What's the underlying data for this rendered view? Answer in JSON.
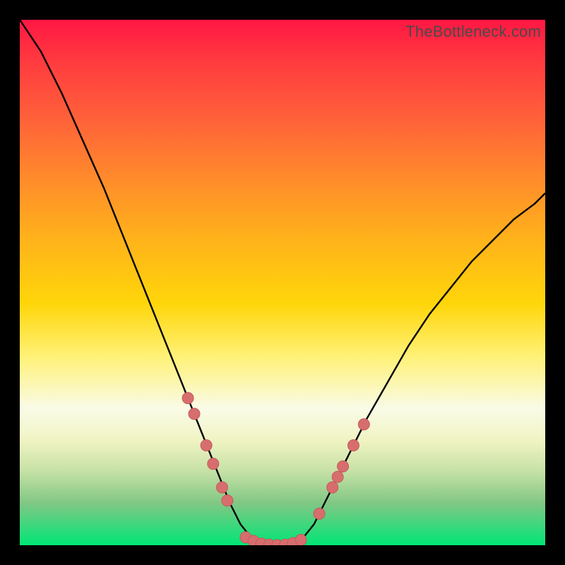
{
  "watermark": {
    "text": "TheBottleneck.com"
  },
  "colors": {
    "curve_stroke": "#000000",
    "marker_fill": "#d76e6e",
    "marker_stroke": "#c65a5a",
    "frame_bg": "#000000"
  },
  "chart_data": {
    "type": "line",
    "title": "",
    "xlabel": "",
    "ylabel": "",
    "xlim": [
      0,
      100
    ],
    "ylim": [
      0,
      100
    ],
    "grid": false,
    "legend": false,
    "series": [
      {
        "name": "bottleneck-curve",
        "x": [
          0,
          4,
          8,
          12,
          16,
          20,
          24,
          28,
          32,
          34,
          36,
          38,
          40,
          42,
          44,
          46,
          48,
          50,
          52,
          54,
          56,
          58,
          62,
          66,
          70,
          74,
          78,
          82,
          86,
          90,
          94,
          98,
          100
        ],
        "y": [
          100,
          94,
          86,
          77,
          68,
          58,
          48,
          38,
          28,
          23,
          18,
          13,
          8,
          4,
          1.5,
          0.5,
          0,
          0,
          0.5,
          1.5,
          4,
          8,
          16,
          24,
          31,
          38,
          44,
          49,
          54,
          58,
          62,
          65,
          67
        ]
      }
    ],
    "markers": [
      {
        "x": 32.0,
        "y": 28.0
      },
      {
        "x": 33.2,
        "y": 25.0
      },
      {
        "x": 35.5,
        "y": 19.0
      },
      {
        "x": 36.8,
        "y": 15.5
      },
      {
        "x": 38.5,
        "y": 11.0
      },
      {
        "x": 39.5,
        "y": 8.5
      },
      {
        "x": 43.0,
        "y": 1.5
      },
      {
        "x": 44.5,
        "y": 0.8
      },
      {
        "x": 46.0,
        "y": 0.3
      },
      {
        "x": 47.5,
        "y": 0.1
      },
      {
        "x": 49.0,
        "y": 0.0
      },
      {
        "x": 50.5,
        "y": 0.1
      },
      {
        "x": 52.0,
        "y": 0.4
      },
      {
        "x": 53.5,
        "y": 1.0
      },
      {
        "x": 57.0,
        "y": 6.0
      },
      {
        "x": 59.5,
        "y": 11.0
      },
      {
        "x": 60.5,
        "y": 13.0
      },
      {
        "x": 61.5,
        "y": 15.0
      },
      {
        "x": 63.5,
        "y": 19.0
      },
      {
        "x": 65.5,
        "y": 23.0
      }
    ]
  }
}
